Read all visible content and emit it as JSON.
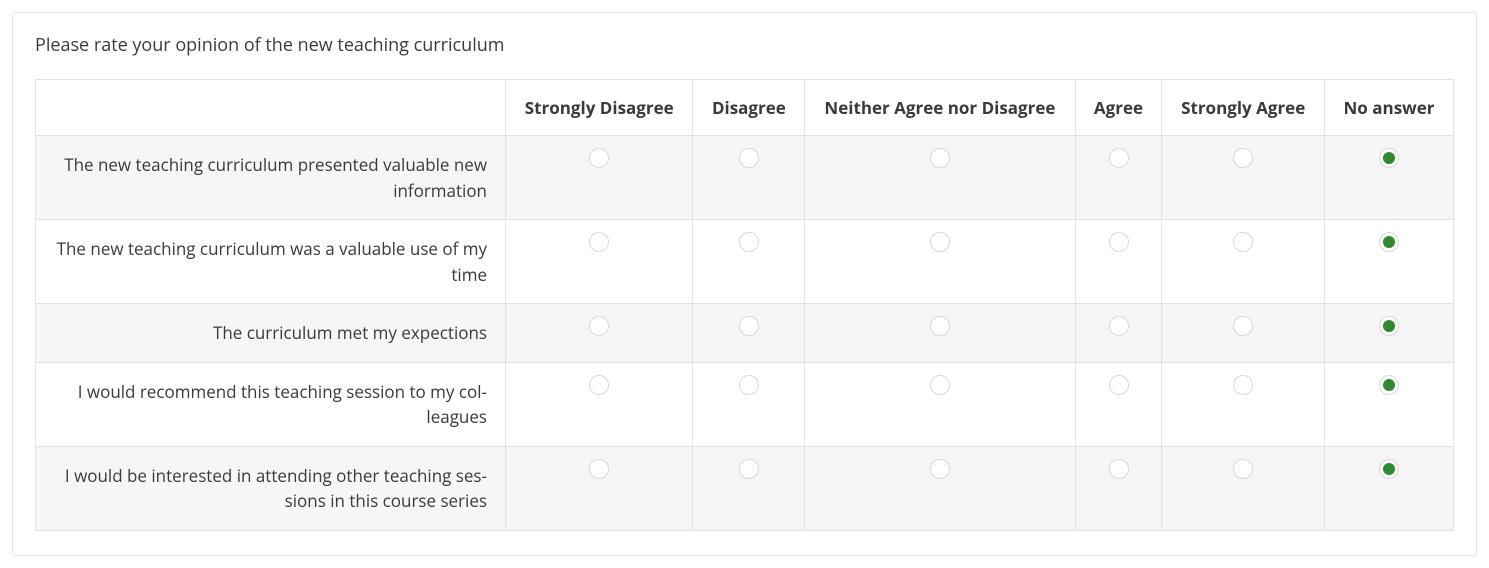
{
  "question": {
    "title": "Please rate your opinion of the new teaching curriculum"
  },
  "scale": {
    "options": [
      "Strongly Disagree",
      "Disagree",
      "Neither Agree nor Disagree",
      "Agree",
      "Strongly Agree",
      "No answer"
    ]
  },
  "rows": [
    {
      "label": "The new teaching curriculum presented valuable new information",
      "selected_index": 5
    },
    {
      "label": "The new teaching curriculum was a valuable use of my time",
      "selected_index": 5
    },
    {
      "label": "The curriculum met my expections",
      "selected_index": 5
    },
    {
      "label": "I would recommend this teaching session to my col­leagues",
      "selected_index": 5
    },
    {
      "label": "I would be interested in attending other teaching ses­sions in this course series",
      "selected_index": 5
    }
  ],
  "colors": {
    "accent": "#2f8a2f"
  }
}
